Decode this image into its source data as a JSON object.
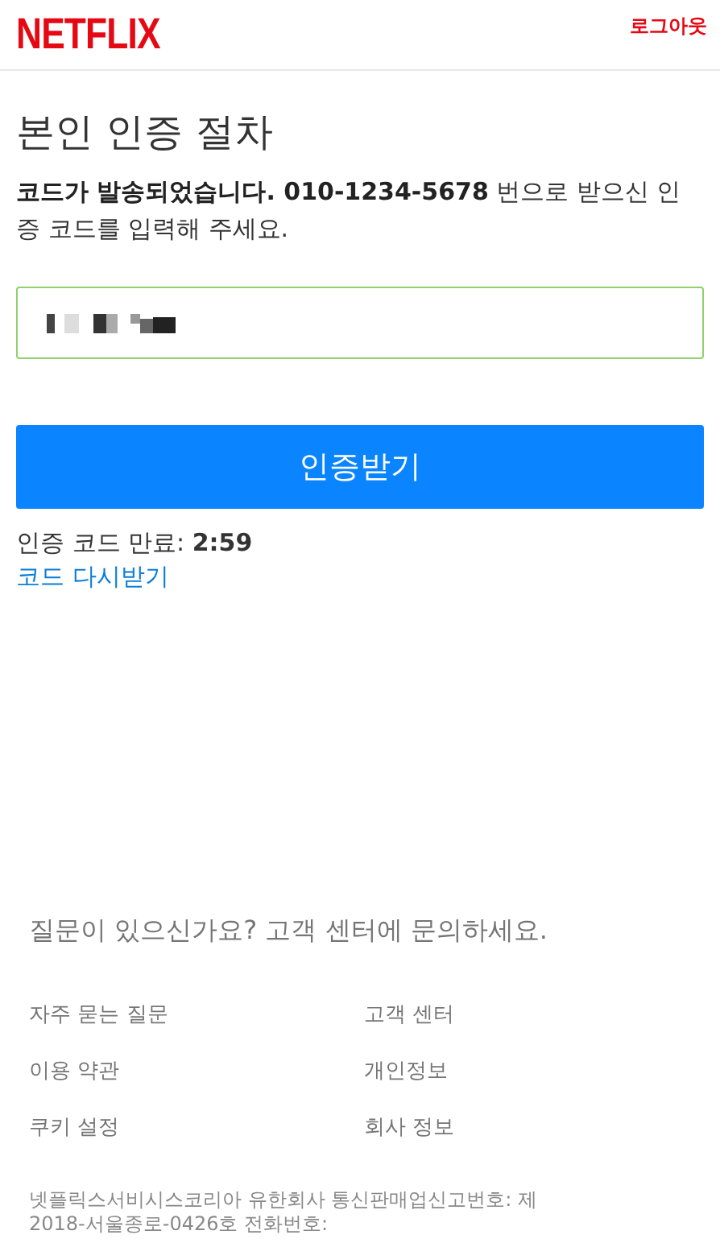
{
  "header": {
    "logo": "NETFLIX",
    "logout": "로그아웃"
  },
  "title": "본인 인증 절차",
  "message": "**코드가 발송되었습니다. 010-1234-5678** 번으로 받으신 인증 코드를 입력해 주세요.",
  "code_field": {
    "focused": true,
    "value_redacted": true
  },
  "submit_button": "인증받기",
  "expiry": {
    "label": "인증 코드 만료:",
    "time": "2:59"
  },
  "resend_link": "코드 다시받기",
  "footer": {
    "question": "질문이 있으신가요? 고객 센터에 문의하세요.",
    "links": [
      "자주 묻는 질문",
      "고객 센터",
      "이용 약관",
      "개인정보",
      "쿠키 설정",
      "회사 정보"
    ],
    "legal": "넷플릭스서비시스코리아 유한회사 통신판매업신고번호: 제2018-서울종로-0426호 전화번호:"
  }
}
